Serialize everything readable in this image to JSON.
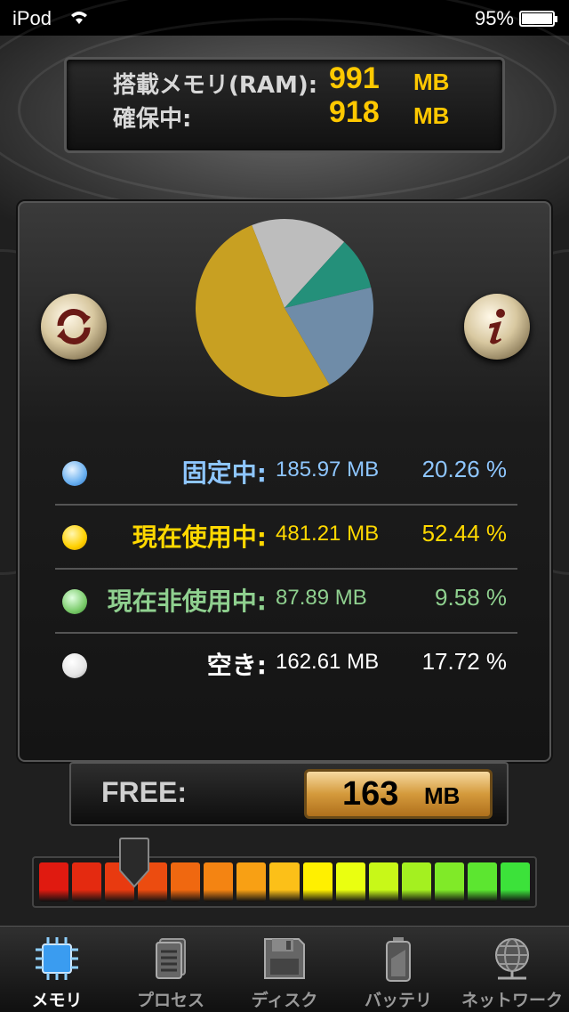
{
  "status_bar": {
    "carrier": "iPod",
    "battery": "95%"
  },
  "header": {
    "ram_label": "搭載メモリ(RAM):",
    "ram_value": "991",
    "ram_unit": "MB",
    "reserved_label": "確保中:",
    "reserved_value": "918",
    "reserved_unit": "MB"
  },
  "buttons": {
    "refresh_icon": "refresh-icon",
    "info_icon": "info-icon"
  },
  "legend": [
    {
      "label": "固定中:",
      "mb": "185.97 MB",
      "pct": "20.26 %",
      "color": "#8ec6ff"
    },
    {
      "label": "現在使用中:",
      "mb": "481.21 MB",
      "pct": "52.44 %",
      "color": "#ffd800"
    },
    {
      "label": "現在非使用中:",
      "mb": "87.89 MB",
      "pct": "9.58 %",
      "color": "#8fd08f"
    },
    {
      "label": "空き:",
      "mb": "162.61 MB",
      "pct": "17.72 %",
      "color": "#ffffff"
    }
  ],
  "chart_data": {
    "type": "pie",
    "slices": [
      {
        "label": "固定中",
        "value": 20.26,
        "color": "#6f8ca8"
      },
      {
        "label": "現在使用中",
        "value": 52.44,
        "color": "#c8a022"
      },
      {
        "label": "現在非使用中",
        "value": 9.58,
        "color": "#24907a"
      },
      {
        "label": "空き",
        "value": 17.72,
        "color": "#bdbdbd"
      }
    ]
  },
  "free": {
    "label": "FREE:",
    "value": "163",
    "unit": "MB",
    "level_fraction": 0.2
  },
  "tabs": [
    {
      "label": "メモリ",
      "icon": "memory-chip-icon",
      "active": true
    },
    {
      "label": "プロセス",
      "icon": "process-document-icon",
      "active": false
    },
    {
      "label": "ディスク",
      "icon": "disk-floppy-icon",
      "active": false
    },
    {
      "label": "バッテリ",
      "icon": "battery-icon",
      "active": false
    },
    {
      "label": "ネットワーク",
      "icon": "network-globe-icon",
      "active": false
    }
  ]
}
